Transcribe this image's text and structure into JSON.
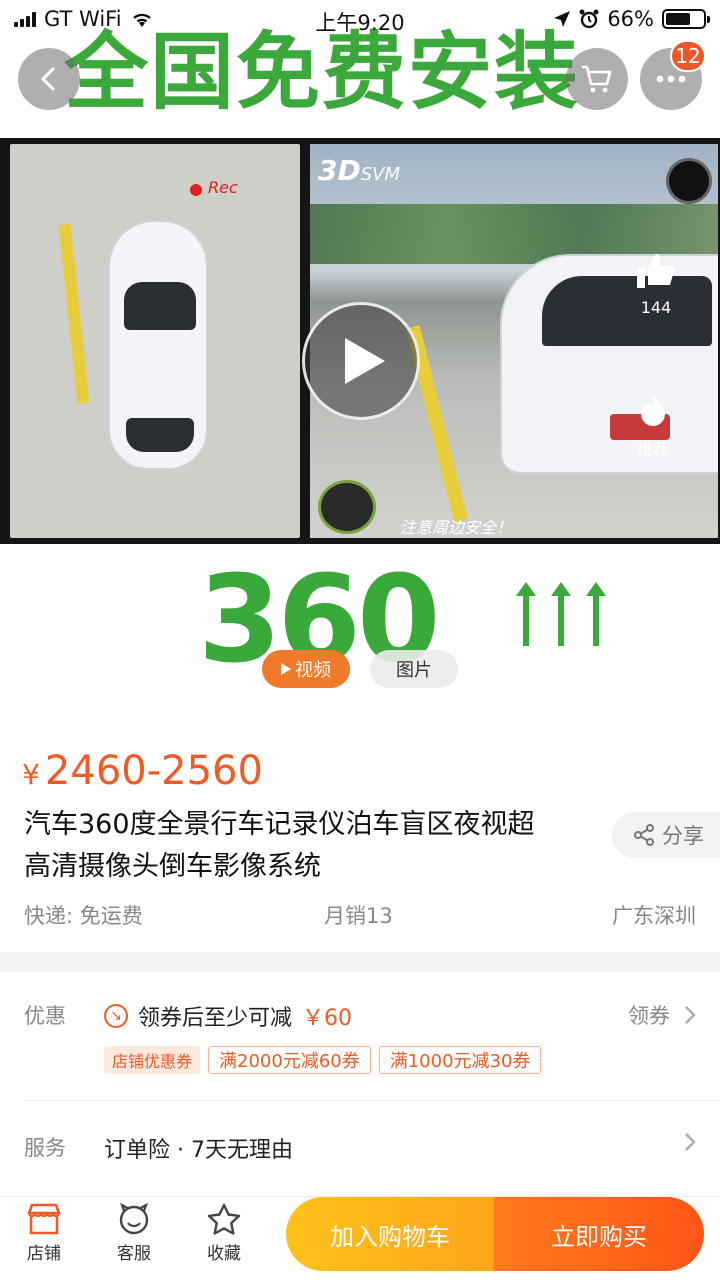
{
  "status_bar": {
    "carrier": "GT WiFi",
    "time": "上午9:20",
    "battery": "66%",
    "battery_level": 0.66
  },
  "header": {
    "promo_banner": "全国免费安装",
    "cart_badge": "12"
  },
  "media": {
    "brand_text": "3D",
    "brand_sub": "SVM",
    "rec_label": "Rec",
    "safety_note": "注意周边安全！",
    "like_count": "144",
    "recommend_label": "推荐",
    "big_number": "360",
    "tab_video": "视频",
    "tab_image": "图片"
  },
  "product": {
    "currency": "¥",
    "price_range": "2460-2560",
    "title_line1": "汽车360度全景行车记录仪泊车盲区夜视超",
    "title_line2": "高清摄像头倒车影像系统",
    "share_label": "分享",
    "shipping": "快递: 免运费",
    "monthly_sales": "月销13",
    "location": "广东深圳"
  },
  "promotions": {
    "label": "优惠",
    "coupon_text": "领券后至少可减",
    "coupon_amount": "￥60",
    "get_coupon": "领券",
    "tag_shop": "店铺优惠券",
    "tags": [
      "满2000元减60券",
      "满1000元减30券"
    ]
  },
  "service": {
    "label": "服务",
    "text": "订单险 · 7天无理由"
  },
  "bottom_bar": {
    "shop": "店铺",
    "service": "客服",
    "favorite": "收藏",
    "add_to_cart": "加入购物车",
    "buy_now": "立即购买"
  },
  "colors": {
    "accent": "#f15a24",
    "promo_green": "#3aa83a",
    "cart_button": "#ffb11a",
    "buy_button": "#ff6a1a"
  }
}
